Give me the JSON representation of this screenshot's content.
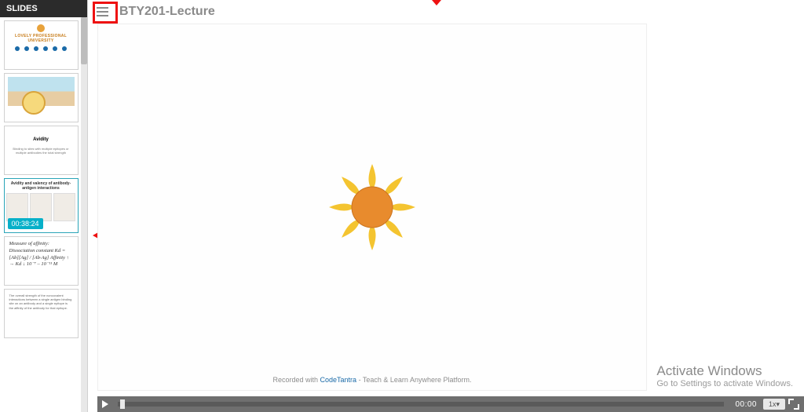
{
  "sidebar": {
    "header": "SLIDES",
    "thumbs": [
      {
        "title": "LOVELY PROFESSIONAL UNIVERSITY"
      },
      {
        "title": ""
      },
      {
        "title": "Avidity",
        "body": "Binding to sites with multiple epitopes or multiple antibodies the total strength"
      },
      {
        "title": "Avidity and valency of antibody-antigen interactions",
        "timestamp": "00:38:24"
      },
      {
        "lines": "Measure of affinity:\nDissociation constant\nKd = [Ab][Ag] / [Ab·Ag]\nAffinity ↑ → Kd ↓\n10⁻⁷ – 10⁻¹¹ M"
      },
      {
        "body": "The overall strength of the noncovalent interactions between a single antigen binding site on an antibody and a single epitope is the affinity of the antibody for that epitope."
      }
    ]
  },
  "menu_label": "Menu Option",
  "page_title": "BTY201-Lecture",
  "footer": {
    "prefix": "Recorded with ",
    "brand": "CodeTantra",
    "suffix": " - Teach & Learn Anywhere Platform."
  },
  "player": {
    "time": "00:00",
    "speed": "1x"
  },
  "watermark": {
    "line1": "Activate Windows",
    "line2": "Go to Settings to activate Windows."
  }
}
